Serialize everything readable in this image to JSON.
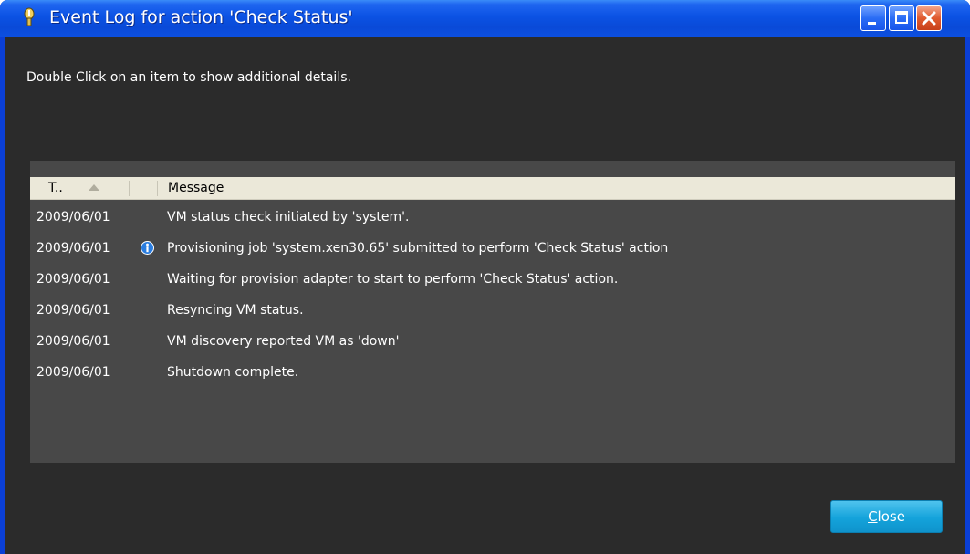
{
  "window": {
    "title": "Event Log for action 'Check Status'"
  },
  "hint": "Double Click on an item to show additional details.",
  "table": {
    "columns": [
      "T..",
      "Message"
    ],
    "sort": {
      "column": "T..",
      "direction": "ascending"
    },
    "rows": [
      {
        "time": "2009/06/01",
        "icon": "",
        "message": "VM status check initiated by 'system'."
      },
      {
        "time": "2009/06/01",
        "icon": "info-icon",
        "message": "Provisioning job 'system.xen30.65' submitted to perform 'Check Status' action"
      },
      {
        "time": "2009/06/01",
        "icon": "",
        "message": "Waiting for provision adapter to start to perform 'Check Status' action."
      },
      {
        "time": "2009/06/01",
        "icon": "",
        "message": "Resyncing VM status."
      },
      {
        "time": "2009/06/01",
        "icon": "",
        "message": "VM discovery reported VM as 'down'"
      },
      {
        "time": "2009/06/01",
        "icon": "",
        "message": "Shutdown complete."
      }
    ]
  },
  "buttons": {
    "close_mnemonic": "C",
    "close_rest": "lose"
  }
}
